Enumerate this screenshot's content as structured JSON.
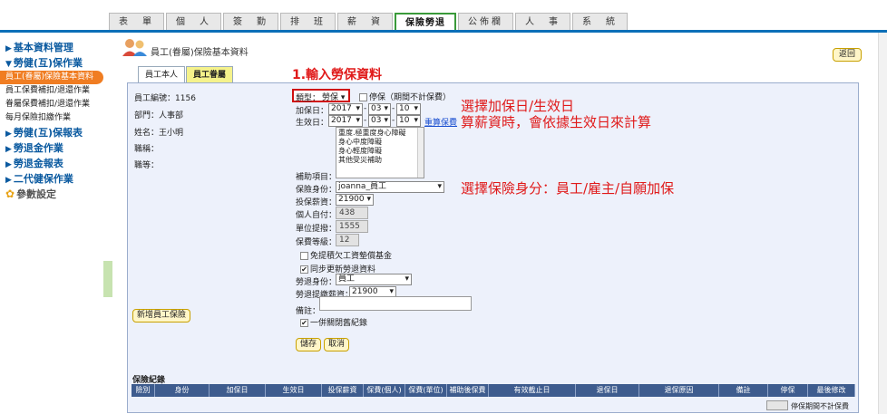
{
  "nav": {
    "tabs": [
      "表　單",
      "個　人",
      "簽　勤",
      "排　班",
      "薪　資",
      "保險勞退",
      "公佈欄",
      "人　事",
      "系　統"
    ],
    "active_index": 5
  },
  "sidebar": {
    "sections": {
      "basic": "基本資料管理",
      "labor_insurance": "勞健(互)保作業",
      "labor_report": "勞健(互)保報表",
      "pension": "勞退金作業",
      "pension_report": "勞退金報表",
      "nhi2": "二代健保作業",
      "params": "參數設定"
    },
    "items": [
      "員工(眷屬)保險基本資料",
      "員工保費補扣/退還作業",
      "眷屬保費補扣/退還作業",
      "每月保險扣繳作業"
    ]
  },
  "page": {
    "title": "員工(眷屬)保險基本資料",
    "back_label": "返回",
    "tab_self": "員工本人",
    "tab_family": "員工眷屬"
  },
  "employee": {
    "id_label": "員工編號：",
    "id_value": "1156",
    "dept_label": "部門：",
    "dept_value": "人事部",
    "name_label": "姓名：",
    "name_value": "王小明",
    "title_label": "職稱：",
    "grade_label": "職等：",
    "add_button": "新增員工保險"
  },
  "annotations": {
    "step1": "1.輸入勞保資料",
    "date_note_1": "選擇加保日/生效日",
    "date_note_2": "算薪資時，會依據生效日來計算",
    "identity_note": "選擇保險身分：員工/雇主/自願加保"
  },
  "form": {
    "type_label": "類型：",
    "type_value": "勞保",
    "suspend_label": "停保（期間不計保費）",
    "add_date_label": "加保日：",
    "effective_date_label": "生效日：",
    "year": "2017",
    "month": "03",
    "day": "10",
    "recalc_link": "重算保費",
    "subsidy_options": [
      "重度.極重度身心障礙",
      "身心中度障礙",
      "身心輕度障礙",
      "其他受災補助"
    ],
    "subsidy_label": "補助項目：",
    "identity_label": "保險身份：",
    "identity_value": "joanna_員工",
    "salary_label": "投保薪資：",
    "salary_value": "21900",
    "self_pay_label": "個人自付：",
    "self_pay_value": "438",
    "company_label": "單位提撥：",
    "company_value": "1555",
    "grade_label": "保費等級：",
    "grade_value": "12",
    "exempt_label": "免提積欠工資墊償基金",
    "sync_label": "同步更新勞退資料",
    "pension_identity_label": "勞退身份：",
    "pension_identity_value": "員工",
    "pension_salary_label": "勞退提繳薪資：",
    "pension_salary_value": "21900",
    "remark_label": "備註：",
    "close_old_label": "一併關閉舊紀錄",
    "save": "儲存",
    "cancel": "取消"
  },
  "records": {
    "title": "保險紀錄",
    "columns": [
      "險別",
      "身份",
      "加保日",
      "生效日",
      "投保薪資",
      "保費(個人)",
      "保費(單位)",
      "補助後保費",
      "有效截止日",
      "退保日",
      "退保原因",
      "備註",
      "停保",
      "最後修改"
    ],
    "legend": "停保期間不計保費"
  }
}
